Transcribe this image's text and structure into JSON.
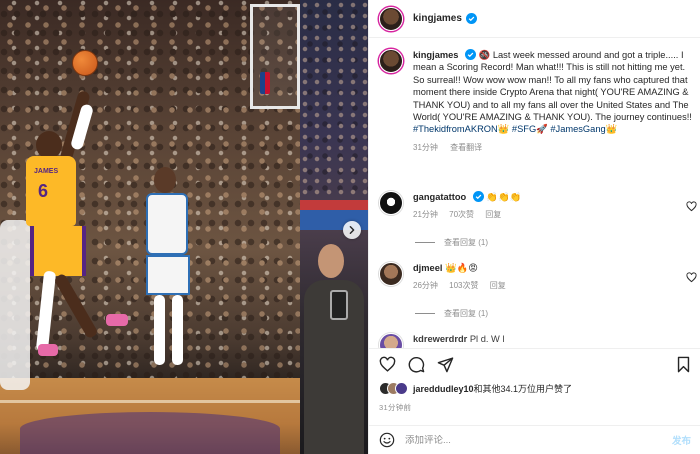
{
  "post": {
    "username": "kingjames",
    "caption_text": "🚳 Last week messed around and got a triple..... I mean a Scoring Record! Man what!!! This is still not hitting me yet. So surreal!! Wow wow wow man!! To all my fans who captured that moment there inside Crypto Arena that night( YOU'RE AMAZING & THANK YOU) and to all my fans all over the United States and The World( YOU'RE AMAZING & THANK YOU). The journey continues!!",
    "hashtag_1": "#ThekidfromAKRON",
    "emoji_1": "👑",
    "hashtag_2": "#SFG",
    "emoji_2": "🚀",
    "hashtag_3": "#JamesGang",
    "emoji_3": "👑",
    "caption_time": "31分钟",
    "see_translation": "查看翻译"
  },
  "comments": [
    {
      "username": "gangatattoo",
      "text": "👏👏👏",
      "time": "21分钟",
      "likes": "70次赞",
      "reply": "回复",
      "view_replies": "查看回复 (1)"
    },
    {
      "username": "djmeel",
      "text": "👑🔥😡",
      "time": "26分钟",
      "likes": "103次赞",
      "reply": "回复",
      "view_replies": "查看回复 (1)"
    },
    {
      "username": "kdrewerdrdr",
      "text": "Pl d. W l"
    }
  ],
  "liked_by": {
    "user": "jareddudley10",
    "rest": "和其他34.1万位用户赞了"
  },
  "post_time": "31分钟前",
  "composer": {
    "placeholder": "添加评论...",
    "post_label": "发布"
  },
  "colors": {
    "verified": "#0095f6",
    "link": "#00376b",
    "muted": "#8e8e8e",
    "post_disabled": "#b2dffc"
  },
  "icons": {
    "like": "heart-icon",
    "comment": "comment-icon",
    "share": "paper-plane-icon",
    "save": "bookmark-icon",
    "emoji": "smiley-icon",
    "next": "chevron-right-icon"
  }
}
